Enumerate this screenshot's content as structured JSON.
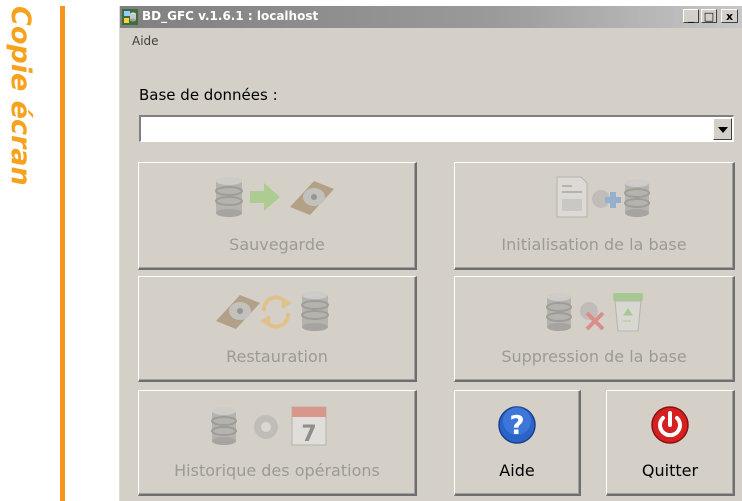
{
  "side_label": "Copie écran",
  "window": {
    "title": "BD_GFC v.1.6.1 : localhost",
    "controls": {
      "minimize": "_",
      "maximize": "□",
      "close": "x"
    }
  },
  "menu": {
    "items": [
      {
        "label": "Aide"
      }
    ]
  },
  "database": {
    "label": "Base de données :",
    "value": ""
  },
  "buttons": {
    "sauvegarde": {
      "label": "Sauvegarde",
      "icons": [
        "database-icon",
        "arrow-right-icon",
        "hard-disk-icon"
      ],
      "enabled": false
    },
    "initialisation": {
      "label": "Initialisation de la base",
      "icons": [
        "document-icon",
        "gear-plus-icon",
        "database-icon"
      ],
      "enabled": false
    },
    "restauration": {
      "label": "Restauration",
      "icons": [
        "hard-disk-icon",
        "refresh-icon",
        "database-icon"
      ],
      "enabled": false
    },
    "suppression": {
      "label": "Suppression de la base",
      "icons": [
        "database-icon",
        "gear-delete-icon",
        "recycle-bin-icon"
      ],
      "enabled": false
    },
    "historique": {
      "label": "Historique des opérations",
      "icons": [
        "database-icon",
        "gear-icon",
        "calendar-icon"
      ],
      "calendar_day": "7",
      "enabled": false
    },
    "aide": {
      "label": "Aide",
      "icon": "help-icon",
      "glyph": "?",
      "enabled": true
    },
    "quitter": {
      "label": "Quitter",
      "icon": "power-icon",
      "enabled": true
    }
  },
  "colors": {
    "accent_orange": "#f7941d",
    "window_bg": "#d4d0c8",
    "help_blue": "#2a64c8",
    "quit_red": "#d42020"
  }
}
